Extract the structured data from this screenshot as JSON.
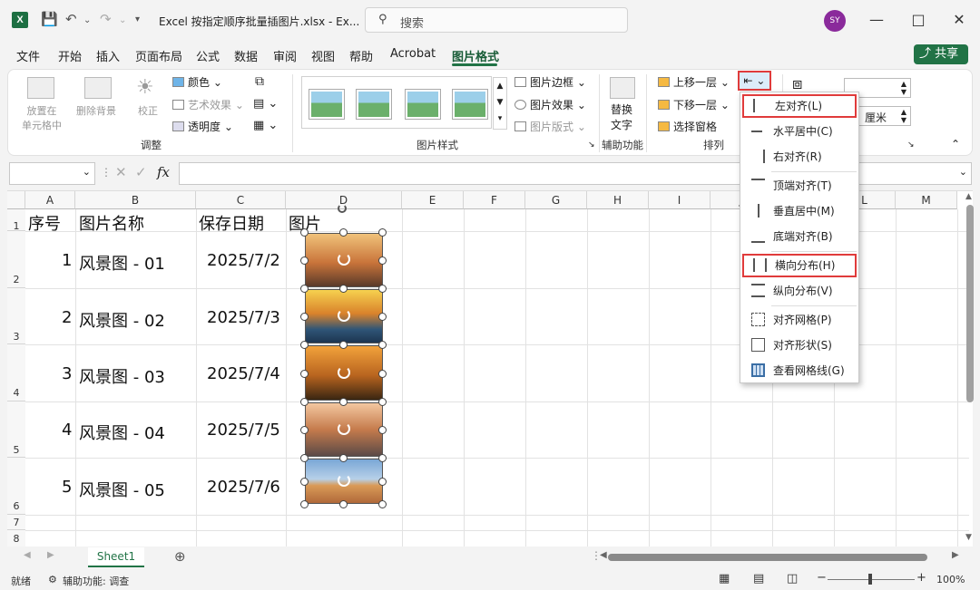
{
  "titlebar": {
    "app_logo": "X",
    "document_title": "Excel 按指定顺序批量插图片.xlsx  -  Ex...",
    "search_placeholder": "搜索",
    "user_initials": "SY",
    "icons": [
      "excel-icon",
      "save-icon",
      "undo-icon",
      "redo-icon",
      "customize-qat-icon",
      "search-icon",
      "minimize-icon",
      "maximize-icon",
      "close-icon"
    ]
  },
  "menu": {
    "items": [
      "文件",
      "开始",
      "插入",
      "页面布局",
      "公式",
      "数据",
      "审阅",
      "视图",
      "帮助",
      "Acrobat",
      "图片格式"
    ],
    "active": "图片格式",
    "share_label": "共享"
  },
  "ribbon": {
    "adjust": {
      "place_in_cell": "放置在\n单元格中",
      "remove_bg": "删除背景",
      "corrections": "校正",
      "color": "颜色",
      "artistic": "艺术效果",
      "transparency": "透明度",
      "group_label": "调整"
    },
    "styles": {
      "picture_border": "图片边框",
      "picture_effects": "图片效果",
      "picture_layout": "图片版式",
      "group_label": "图片样式"
    },
    "accessibility": {
      "alt_text": "替换\n文字",
      "group_label": "辅助功能"
    },
    "arrange": {
      "bring_forward": "上移一层",
      "send_backward": "下移一层",
      "selection_pane": "选择窗格",
      "group_label": "排列"
    },
    "size": {
      "unit": "厘米"
    }
  },
  "formula_bar": {
    "fx": "fx",
    "name_box": "",
    "content": ""
  },
  "sheet": {
    "columns": [
      "A",
      "B",
      "C",
      "D",
      "E",
      "F",
      "G",
      "H",
      "I",
      "J",
      "K",
      "L",
      "M"
    ],
    "rows": [
      "1",
      "2",
      "3",
      "4",
      "5",
      "6",
      "7",
      "8"
    ],
    "header": [
      "序号",
      "图片名称",
      "保存日期",
      "图片"
    ],
    "data": [
      {
        "no": "1",
        "name": "风景图 - 01",
        "date": "2025/7/2"
      },
      {
        "no": "2",
        "name": "风景图 - 02",
        "date": "2025/7/3"
      },
      {
        "no": "3",
        "name": "风景图 - 03",
        "date": "2025/7/4"
      },
      {
        "no": "4",
        "name": "风景图 - 04",
        "date": "2025/7/5"
      },
      {
        "no": "5",
        "name": "风景图 - 05",
        "date": "2025/7/6"
      }
    ],
    "picture_colors": [
      "#c9743a",
      "#d9822b",
      "#b8641f",
      "#c57b4c",
      "#7aa7d6"
    ]
  },
  "align_menu": {
    "items": [
      {
        "label": "左对齐(L)",
        "highlighted": true
      },
      {
        "label": "水平居中(C)"
      },
      {
        "label": "右对齐(R)"
      },
      {
        "label": "顶端对齐(T)"
      },
      {
        "label": "垂直居中(M)"
      },
      {
        "label": "底端对齐(B)"
      },
      {
        "label": "横向分布(H)",
        "highlighted": true
      },
      {
        "label": "纵向分布(V)"
      },
      {
        "label": "对齐网格(P)"
      },
      {
        "label": "对齐形状(S)"
      },
      {
        "label": "查看网格线(G)"
      }
    ]
  },
  "sheet_tabs": {
    "active": "Sheet1"
  },
  "status_bar": {
    "ready": "就绪",
    "accessibility": "辅助功能: 调查",
    "zoom": "100%"
  },
  "colors": {
    "accent": "#217346",
    "highlight_box": "#e03b3b"
  }
}
